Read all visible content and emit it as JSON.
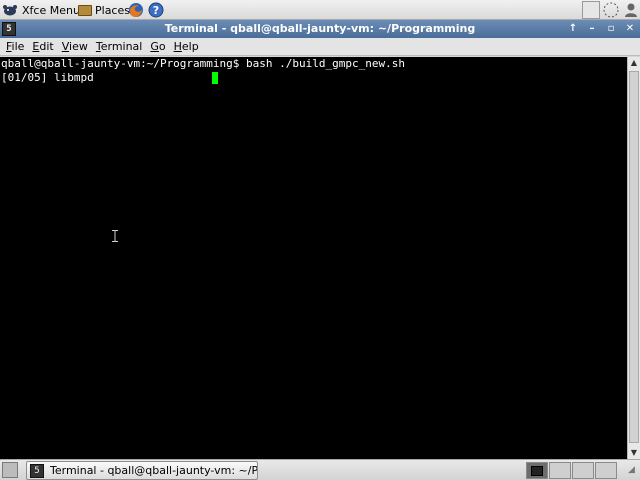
{
  "top_panel": {
    "xfce_menu_label": "Xfce Menu",
    "places_label": "Places",
    "icons": [
      "xfce-mouse-icon",
      "folder-icon",
      "firefox-icon",
      "help-icon",
      "notification-icon",
      "clock-icon",
      "user-icon"
    ]
  },
  "window": {
    "title": "Terminal - qball@qball-jaunty-vm: ~/Programming",
    "icon_glyph": "5",
    "buttons": {
      "up": "↑",
      "minimize": "–",
      "maximize": "▫",
      "close": "✕"
    }
  },
  "menubar": {
    "items": [
      {
        "underline": "F",
        "rest": "ile"
      },
      {
        "underline": "E",
        "rest": "dit"
      },
      {
        "underline": "V",
        "rest": "iew"
      },
      {
        "underline": "T",
        "rest": "erminal"
      },
      {
        "underline": "G",
        "rest": "o"
      },
      {
        "underline": "H",
        "rest": "elp"
      }
    ]
  },
  "terminal": {
    "line1": "qball@qball-jaunty-vm:~/Programming$ bash ./build_gmpc_new.sh",
    "line2": "[01/05] libmpd",
    "cursor_color": "#00ff00",
    "background": "#000000"
  },
  "bottom_panel": {
    "task_label": "Terminal - qball@qball-jaunty-vm: ~/Pro...",
    "task_icon_glyph": "5",
    "resize_glyph": "◢"
  },
  "colors": {
    "titlebar": "#5a7da7",
    "accent_green": "#00ff00"
  }
}
